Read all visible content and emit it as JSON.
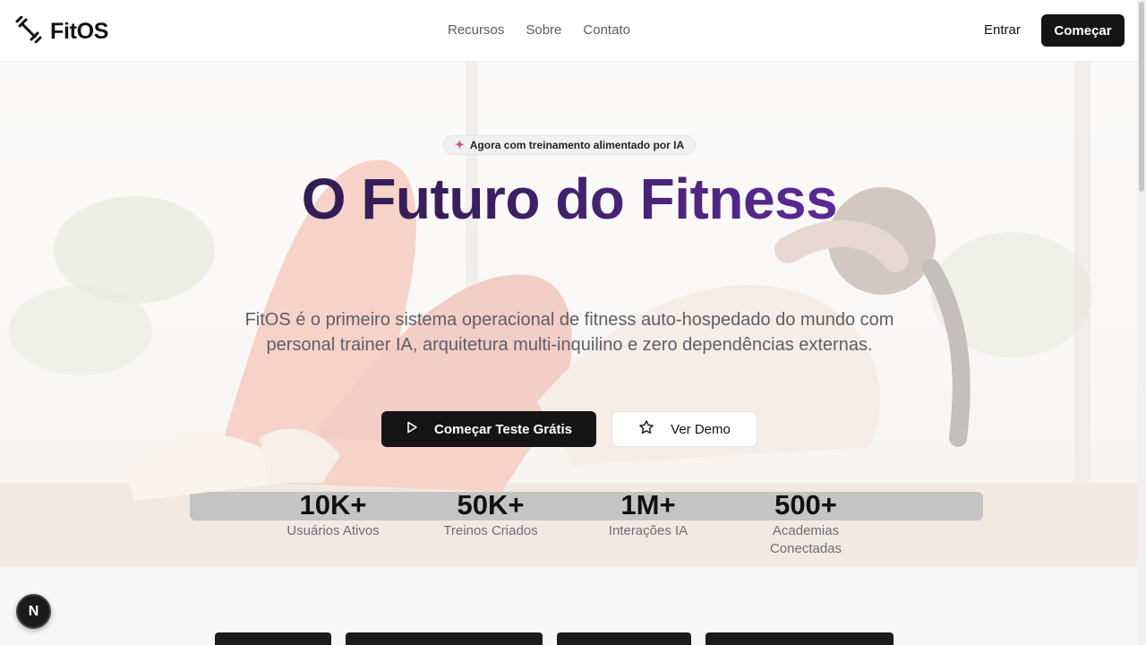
{
  "header": {
    "brand": "FitOS",
    "nav": [
      "Recursos",
      "Sobre",
      "Contato"
    ],
    "login_label": "Entrar",
    "cta_label": "Começar"
  },
  "hero": {
    "badge": "Agora com treinamento alimentado por IA",
    "badge_icon": "rocket-icon",
    "title": "O Futuro do Fitness",
    "subtitle": "FitOS é o primeiro sistema operacional de fitness auto-hospedado do mundo com personal trainer IA, arquitetura multi-inquilino e zero dependências externas.",
    "primary_button": "Começar Teste Grátis",
    "secondary_button": "Ver Demo",
    "stats": [
      {
        "value": "10K+",
        "label": "Usuários Ativos"
      },
      {
        "value": "50K+",
        "label": "Treinos Criados"
      },
      {
        "value": "1M+",
        "label": "Interações IA"
      },
      {
        "value": "500+",
        "label": "Academias Conectadas"
      }
    ]
  },
  "dev_indicator": {
    "label": "N"
  },
  "colors": {
    "primary": "#151515",
    "title_gradient_start": "#231a3a",
    "title_gradient_end": "#7a33c6",
    "accent": "#d0508a"
  }
}
